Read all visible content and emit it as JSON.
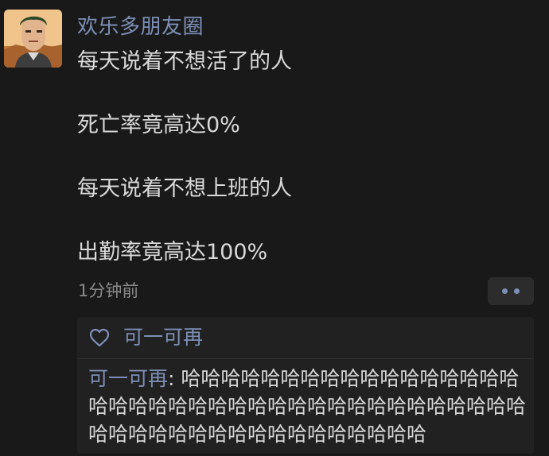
{
  "post": {
    "author": "欢乐多朋友圈",
    "lines": [
      "每天说着不想活了的人",
      "死亡率竟高达0%",
      "每天说着不想上班的人",
      "出勤率竟高达100%"
    ],
    "time": "1分钟前"
  },
  "likes": {
    "names": "可一可再"
  },
  "comments": [
    {
      "author": "可一可再",
      "separator": ": ",
      "text": "哈哈哈哈哈哈哈哈哈哈哈哈哈哈哈哈哈哈哈哈哈哈哈哈哈哈哈哈哈哈哈哈哈哈哈哈哈哈哈哈哈哈哈哈哈哈哈哈哈哈哈哈哈哈哈哈"
    }
  ],
  "colors": {
    "background": "#191919",
    "link": "#7d8fb6",
    "text": "#d9d9d9",
    "muted": "#8a8a8a",
    "panel": "#212121"
  },
  "icons": {
    "more": "more-dots-icon",
    "like": "heart-icon"
  }
}
